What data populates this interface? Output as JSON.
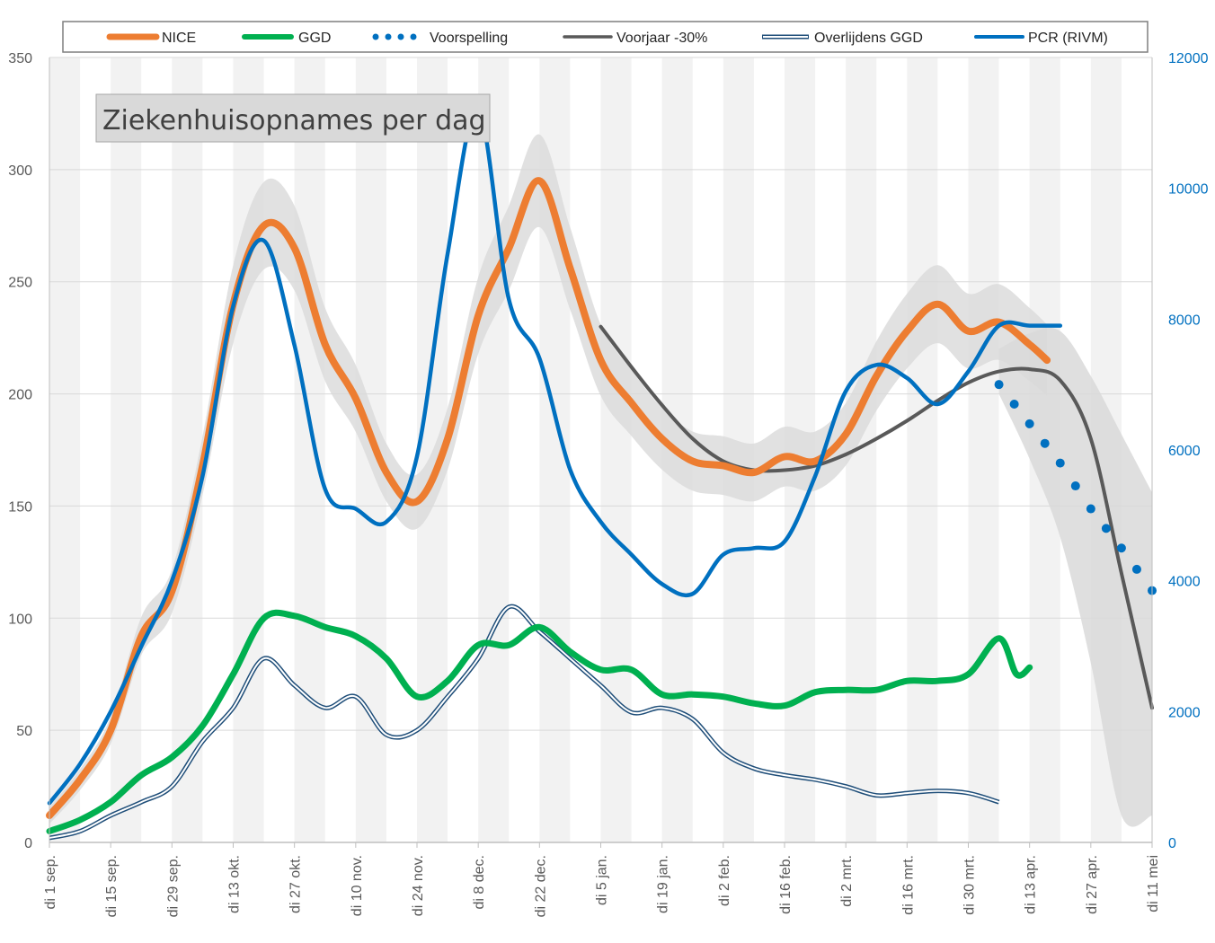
{
  "chart_data": {
    "type": "line",
    "title": "Ziekenhuisopnames per dag",
    "x_tick_labels": [
      "di 1 sep.",
      "di 15 sep.",
      "di 29 sep.",
      "di 13 okt.",
      "di 27 okt.",
      "di 10 nov.",
      "di 24 nov.",
      "di 8 dec.",
      "di 22 dec.",
      "di 5 jan.",
      "di 19 jan.",
      "di 2 feb.",
      "di 16 feb.",
      "di 2 mrt.",
      "di 16 mrt.",
      "di 30 mrt.",
      "di 13 apr.",
      "di 27 apr.",
      "di 11 mei"
    ],
    "x_day_range": [
      0,
      252
    ],
    "y_left": {
      "ticks": [
        0,
        50,
        100,
        150,
        200,
        250,
        300,
        350
      ],
      "range": [
        0,
        350
      ]
    },
    "y_right": {
      "ticks": [
        0,
        2000,
        4000,
        6000,
        8000,
        10000,
        12000
      ],
      "range": [
        0,
        12000
      ]
    },
    "grid": true,
    "alternating_week_bands": true,
    "legend_position": "top",
    "colors": {
      "nice": "#ed7d31",
      "ggd": "#00b050",
      "pcr": "#0070c0",
      "voorjaar": "#595959",
      "overlijdens": "#1f4e79",
      "band": "#d9d9d9"
    },
    "series": [
      {
        "name": "NICE",
        "axis": "left",
        "x": [
          0,
          7,
          14,
          21,
          28,
          35,
          42,
          49,
          56,
          63,
          70,
          77,
          84,
          91,
          98,
          105,
          112,
          119,
          126,
          133,
          140,
          147,
          154,
          161,
          168,
          175,
          182,
          189,
          196,
          203,
          210,
          217,
          224,
          228
        ],
        "values": [
          12,
          28,
          50,
          92,
          112,
          168,
          240,
          275,
          265,
          222,
          198,
          165,
          152,
          180,
          235,
          265,
          295,
          256,
          215,
          196,
          180,
          170,
          168,
          165,
          172,
          170,
          182,
          208,
          228,
          240,
          228,
          232,
          222,
          215
        ]
      },
      {
        "name": "GGD",
        "axis": "left",
        "x": [
          0,
          7,
          14,
          21,
          28,
          35,
          42,
          49,
          56,
          63,
          70,
          77,
          84,
          91,
          98,
          105,
          112,
          119,
          126,
          133,
          140,
          147,
          154,
          161,
          168,
          175,
          182,
          189,
          196,
          203,
          210,
          217,
          221,
          224
        ],
        "values": [
          5,
          10,
          18,
          30,
          38,
          52,
          75,
          100,
          101,
          96,
          92,
          82,
          65,
          72,
          88,
          88,
          96,
          85,
          77,
          77,
          66,
          66,
          65,
          62,
          61,
          67,
          68,
          68,
          72,
          72,
          75,
          91,
          75,
          78
        ]
      },
      {
        "name": "Voorspelling",
        "axis": "right",
        "style": "dotted",
        "x": [
          217,
          224,
          231,
          238,
          245,
          252
        ],
        "values": [
          7000,
          6400,
          5800,
          5100,
          4500,
          3850
        ]
      },
      {
        "name": "Voorjaar -30%",
        "axis": "left",
        "x": [
          126,
          133,
          140,
          147,
          154,
          161,
          168,
          175,
          182,
          189,
          196,
          203,
          210,
          217,
          224,
          231,
          238,
          245,
          252
        ],
        "values": [
          230,
          212,
          195,
          180,
          170,
          166,
          166,
          168,
          173,
          180,
          188,
          197,
          205,
          210,
          211,
          206,
          180,
          120,
          60
        ]
      },
      {
        "name": "Overlijdens GGD",
        "axis": "left",
        "style": "double",
        "x": [
          0,
          7,
          14,
          21,
          28,
          35,
          42,
          49,
          56,
          63,
          70,
          77,
          84,
          91,
          98,
          105,
          112,
          119,
          126,
          133,
          140,
          147,
          154,
          161,
          168,
          175,
          182,
          189,
          196,
          203,
          210,
          217
        ],
        "values": [
          2,
          5,
          12,
          18,
          25,
          45,
          60,
          82,
          70,
          60,
          65,
          48,
          50,
          65,
          82,
          105,
          94,
          82,
          70,
          58,
          60,
          55,
          40,
          33,
          30,
          28,
          25,
          21,
          22,
          23,
          22,
          18
        ]
      },
      {
        "name": "PCR (RIVM)",
        "axis": "right",
        "x": [
          0,
          7,
          14,
          21,
          28,
          35,
          42,
          49,
          56,
          63,
          70,
          77,
          84,
          91,
          98,
          105,
          112,
          119,
          126,
          133,
          140,
          147,
          154,
          161,
          168,
          175,
          182,
          189,
          196,
          203,
          210,
          217,
          224,
          231
        ],
        "values": [
          600,
          1200,
          2000,
          3000,
          4000,
          5600,
          8200,
          9200,
          7600,
          5400,
          5100,
          4900,
          5900,
          9000,
          11200,
          8300,
          7400,
          5700,
          4900,
          4400,
          3950,
          3800,
          4400,
          4500,
          4600,
          5600,
          6900,
          7300,
          7100,
          6700,
          7200,
          7900,
          7900,
          7900
        ]
      }
    ]
  }
}
